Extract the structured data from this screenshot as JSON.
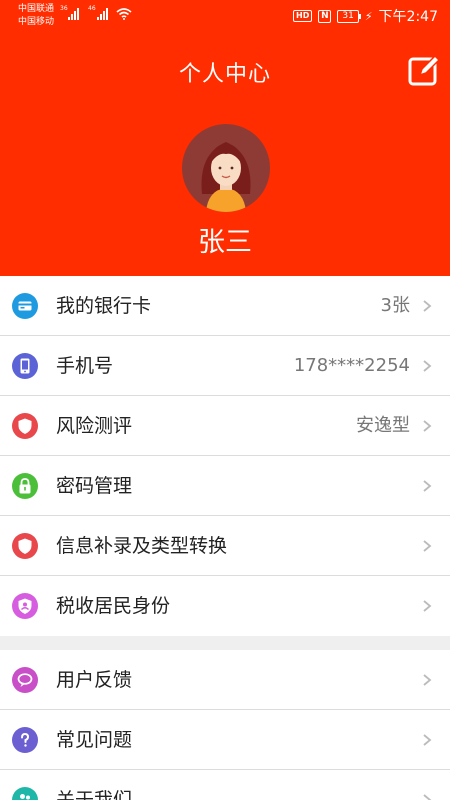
{
  "status_bar": {
    "carrier_1": "中国联通",
    "carrier_2": "中国移动",
    "net_1": "36",
    "net_2": "46",
    "hd": "HD",
    "nfc": "N",
    "battery": "31",
    "time": "下午2:47"
  },
  "header": {
    "title": "个人中心",
    "user_name": "张三",
    "background_color": "#ff2d00"
  },
  "menu_group_1": [
    {
      "label": "我的银行卡",
      "value": "3张",
      "icon": "bank-card-icon",
      "color": "#1e9be0"
    },
    {
      "label": "手机号",
      "value": "178****2254",
      "icon": "phone-icon",
      "color": "#5b63d6"
    },
    {
      "label": "风险测评",
      "value": "安逸型",
      "icon": "shield-icon",
      "color": "#e8474c"
    },
    {
      "label": "密码管理",
      "value": "",
      "icon": "lock-icon",
      "color": "#4cbf3a"
    },
    {
      "label": "信息补录及类型转换",
      "value": "",
      "icon": "shield-icon",
      "color": "#e8474c"
    },
    {
      "label": "税收居民身份",
      "value": "",
      "icon": "id-shield-icon",
      "color": "#d65ce0"
    }
  ],
  "menu_group_2": [
    {
      "label": "用户反馈",
      "value": "",
      "icon": "feedback-icon",
      "color": "#c84fc8"
    },
    {
      "label": "常见问题",
      "value": "",
      "icon": "question-icon",
      "color": "#6b5fd1"
    },
    {
      "label": "关于我们",
      "value": "",
      "icon": "about-icon",
      "color": "#1fb8a8"
    }
  ]
}
